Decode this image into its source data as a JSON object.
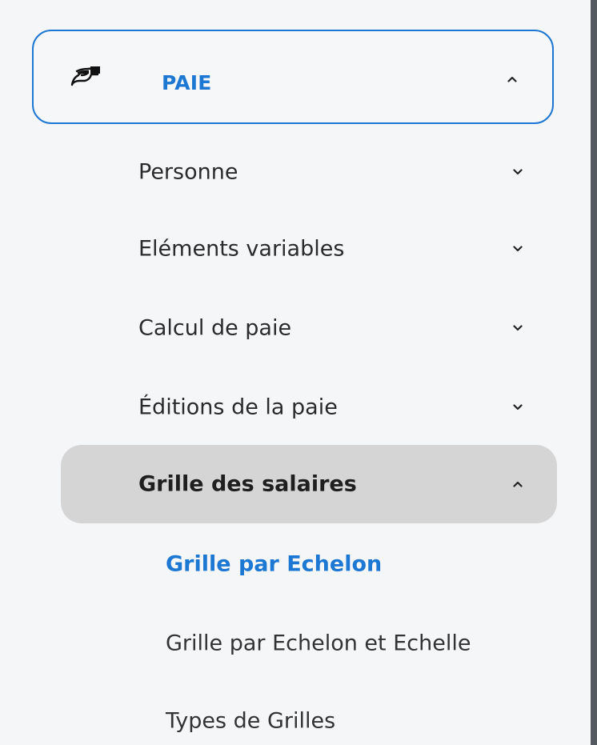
{
  "section": {
    "label": "PAIE",
    "icon": "hand-payment-icon",
    "expanded": true,
    "accent_color": "#1c78d3"
  },
  "menu": {
    "items": [
      {
        "label": "Personne",
        "expanded": false
      },
      {
        "label": "Eléments variables",
        "expanded": false
      },
      {
        "label": "Calcul de paie",
        "expanded": false
      },
      {
        "label": "Éditions de la paie",
        "expanded": false
      },
      {
        "label": "Grille des salaires",
        "expanded": true
      }
    ],
    "subitems": [
      {
        "label": "Grille par Echelon",
        "selected": true
      },
      {
        "label": "Grille par Echelon et Echelle",
        "selected": false
      },
      {
        "label": "Types de Grilles",
        "selected": false
      }
    ]
  }
}
